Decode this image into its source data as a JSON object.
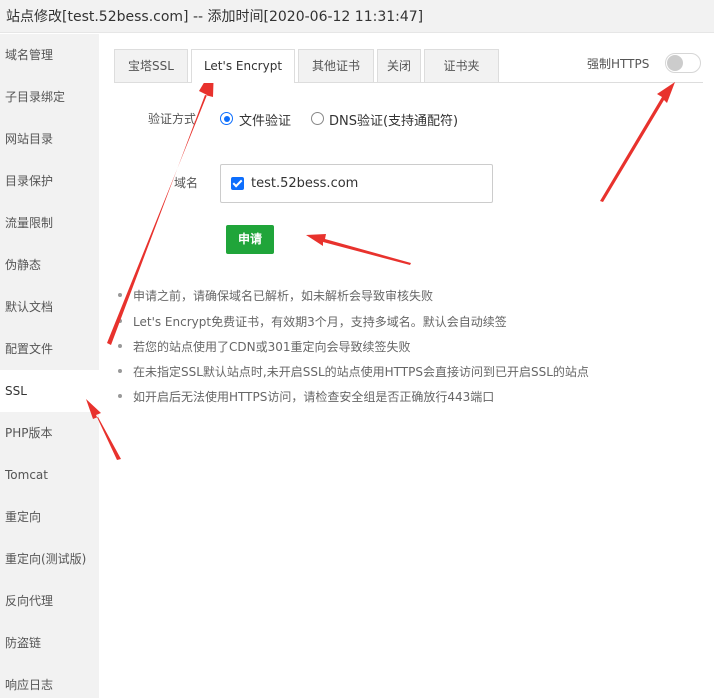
{
  "window": {
    "title": "站点修改[test.52bess.com] -- 添加时间[2020-06-12 11:31:47]"
  },
  "sidebar": {
    "items": [
      {
        "label": "域名管理"
      },
      {
        "label": "子目录绑定"
      },
      {
        "label": "网站目录"
      },
      {
        "label": "目录保护"
      },
      {
        "label": "流量限制"
      },
      {
        "label": "伪静态"
      },
      {
        "label": "默认文档"
      },
      {
        "label": "配置文件"
      },
      {
        "label": "SSL",
        "active": true
      },
      {
        "label": "PHP版本"
      },
      {
        "label": "Tomcat"
      },
      {
        "label": "重定向"
      },
      {
        "label": "重定向(测试版)"
      },
      {
        "label": "反向代理"
      },
      {
        "label": "防盗链"
      },
      {
        "label": "响应日志"
      }
    ]
  },
  "tabs": [
    {
      "label": "宝塔SSL"
    },
    {
      "label": "Let's Encrypt",
      "active": true
    },
    {
      "label": "其他证书"
    },
    {
      "label": "关闭"
    },
    {
      "label": "证书夹"
    }
  ],
  "force_https": {
    "label": "强制HTTPS",
    "on": false
  },
  "verify": {
    "label": "验证方式",
    "options": [
      {
        "label": "文件验证",
        "checked": true
      },
      {
        "label": "DNS验证(支持通配符)",
        "checked": false
      }
    ]
  },
  "domain": {
    "label": "域名",
    "value": "test.52bess.com",
    "checked": true
  },
  "apply_button": {
    "label": "申请"
  },
  "notes": [
    "申请之前，请确保域名已解析，如未解析会导致审核失败",
    "Let's Encrypt免费证书，有效期3个月，支持多域名。默认会自动续签",
    "若您的站点使用了CDN或301重定向会导致续签失败",
    "在未指定SSL默认站点时,未开启SSL的站点使用HTTPS会直接访问到已开启SSL的站点",
    "如开启后无法使用HTTPS访问，请检查安全组是否正确放行443端口"
  ],
  "colors": {
    "accent": "#0d6efd",
    "apply": "#20a53a",
    "arrow": "#e8322d",
    "sidebar_bg": "#f2f2f2"
  }
}
